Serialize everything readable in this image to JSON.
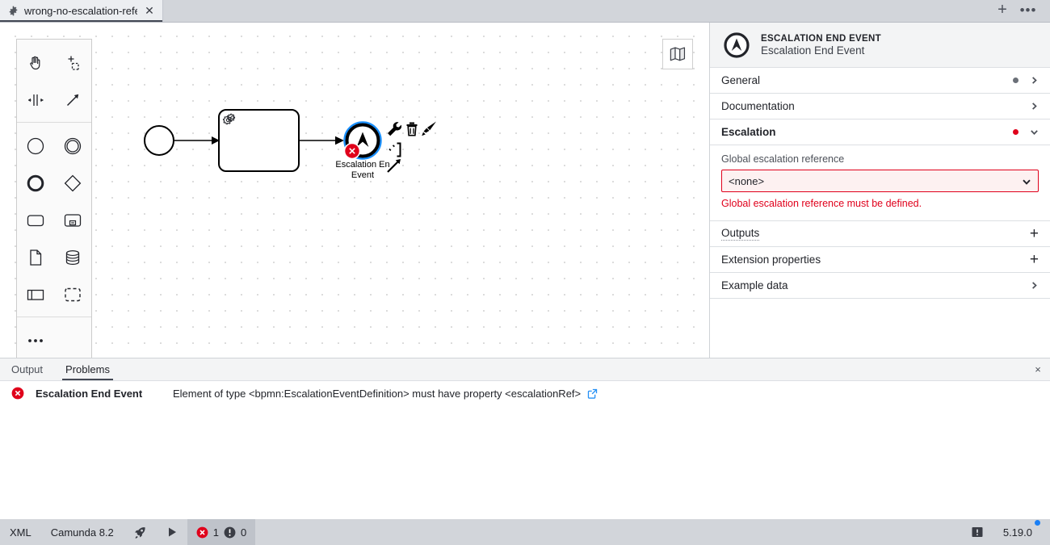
{
  "tabbar": {
    "tab_title": "wrong-no-escalation-refer",
    "gear_icon": "gear-icon",
    "close_icon": "close-icon",
    "plus_label": "+",
    "more_label": "•••"
  },
  "canvas": {
    "palette": {
      "items": [
        {
          "name": "hand-tool",
          "label": "Activate the hand tool"
        },
        {
          "name": "lasso-tool",
          "label": "Activate the lasso tool"
        },
        {
          "name": "space-tool",
          "label": "Activate the create/remove space tool"
        },
        {
          "name": "global-connect-tool",
          "label": "Activate the global connect tool"
        },
        {
          "name": "start-event",
          "label": "Create start event"
        },
        {
          "name": "intermediate-event",
          "label": "Create intermediate/boundary event"
        },
        {
          "name": "end-event",
          "label": "Create end event"
        },
        {
          "name": "gateway",
          "label": "Create gateway"
        },
        {
          "name": "task",
          "label": "Create task"
        },
        {
          "name": "subprocess",
          "label": "Create expanded subprocess"
        },
        {
          "name": "data-object",
          "label": "Create data object reference"
        },
        {
          "name": "data-store",
          "label": "Create data store reference"
        },
        {
          "name": "participant",
          "label": "Create pool/participant"
        },
        {
          "name": "group",
          "label": "Create group"
        },
        {
          "name": "more-elements",
          "label": "•••"
        }
      ]
    },
    "minimap_label": "map-icon",
    "diagram": {
      "start_event": "start-event",
      "service_task": "service-task",
      "end_event_label": "Escalation En\nEvent",
      "end_event_label_line1": "Escalation En",
      "end_event_label_line2": "Event",
      "error_badge": "error-badge"
    },
    "context_pad": [
      {
        "name": "replace",
        "label": "Change element"
      },
      {
        "name": "delete",
        "label": "Remove"
      },
      {
        "name": "set-color",
        "label": "Set color"
      },
      {
        "name": "append-task",
        "label": "Append task"
      },
      {
        "name": "connect",
        "label": "Connect"
      }
    ]
  },
  "properties": {
    "element_type": "ESCALATION END EVENT",
    "element_name": "Escalation End Event",
    "icon": "escalation-end-event-icon",
    "groups": [
      {
        "label": "General",
        "dot": "#6b7078",
        "state": "collapsed"
      },
      {
        "label": "Documentation",
        "dot": null,
        "state": "collapsed"
      },
      {
        "label": "Escalation",
        "dot": "#e0001b",
        "state": "expanded"
      }
    ],
    "escalation": {
      "field_label": "Global escalation reference",
      "value": "<none>",
      "options": [
        "<none>"
      ],
      "error": "Global escalation reference must be defined."
    },
    "footer_groups": [
      {
        "label": "Outputs",
        "action": "+",
        "dotted": true
      },
      {
        "label": "Extension properties",
        "action": "+",
        "dotted": false
      },
      {
        "label": "Example data",
        "action": ">",
        "dotted": false
      }
    ]
  },
  "bottom_panel": {
    "tabs": [
      {
        "label": "Output",
        "active": false
      },
      {
        "label": "Problems",
        "active": true
      }
    ],
    "close_label": "×",
    "problems": [
      {
        "severity": "error",
        "element": "Escalation End Event",
        "message": "Element of type <bpmn:EscalationEventDefinition> must have property <escalationRef>",
        "link": "external-link-icon"
      }
    ]
  },
  "status_bar": {
    "xml_label": "XML",
    "engine_label": "Camunda 8.2",
    "deploy_icon": "rocket-icon",
    "run_icon": "play-icon",
    "error_count": "1",
    "warning_count": "0",
    "feedback_icon": "feedback-icon",
    "version": "5.19.0"
  }
}
